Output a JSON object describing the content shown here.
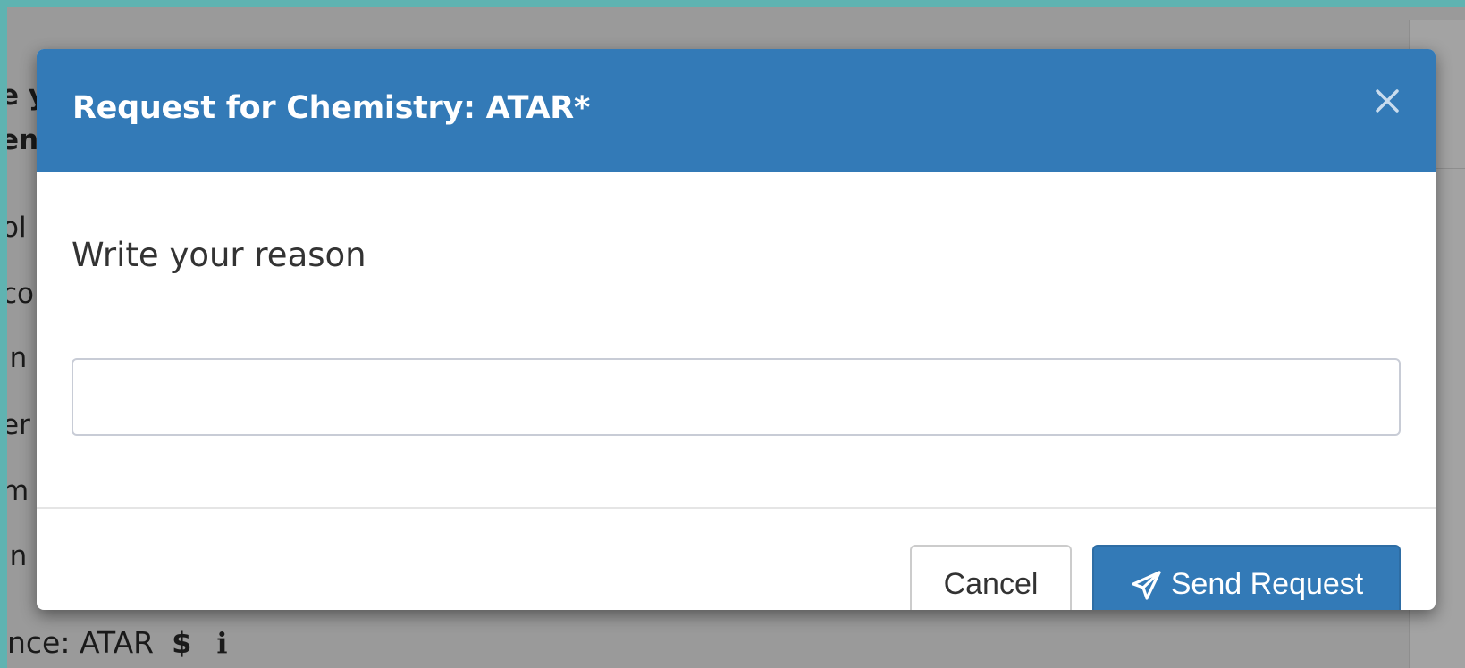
{
  "background": {
    "text_fragments": [
      "e y",
      "en",
      "ol",
      "co",
      "in",
      "er",
      "m",
      "in"
    ],
    "last_line_text": "nce: ATAR",
    "dollar_icon": "$",
    "info_icon": "i"
  },
  "modal": {
    "title": "Request for Chemistry: ATAR*",
    "close_icon": "close-icon",
    "field_label": "Write your reason",
    "reason_value": "",
    "reason_placeholder": "",
    "cancel_label": "Cancel",
    "send_label": "Send Request",
    "send_icon": "paper-plane-icon"
  },
  "colors": {
    "header_blue": "#337ab7",
    "backdrop": "#9a9a9a",
    "frame_teal": "#5fb3b1"
  }
}
